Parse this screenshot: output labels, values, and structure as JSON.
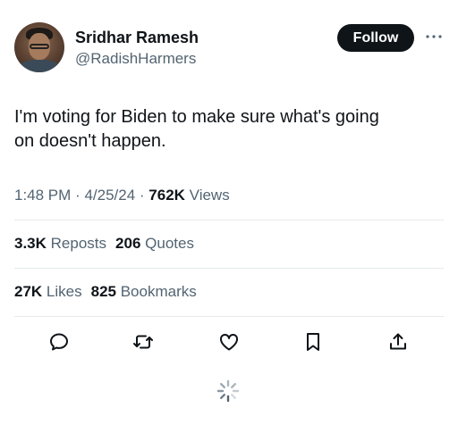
{
  "author": {
    "name": "Sridhar Ramesh",
    "handle": "@RadishHarmers",
    "avatar_icon": "profile-photo"
  },
  "follow_label": "Follow",
  "tweet": {
    "lines": [
      "I'm voting for Biden to make sure what's going",
      "on doesn't happen."
    ],
    "time": "1:48 PM",
    "date": "4/25/24",
    "views_count": "762K",
    "views_label": "Views"
  },
  "stats": {
    "reposts_count": "3.3K",
    "reposts_label": "Reposts",
    "quotes_count": "206",
    "quotes_label": "Quotes",
    "likes_count": "27K",
    "likes_label": "Likes",
    "bookmarks_count": "825",
    "bookmarks_label": "Bookmarks"
  },
  "actions": {
    "icons": [
      "reply-icon",
      "repost-icon",
      "like-icon",
      "bookmark-icon",
      "share-icon"
    ]
  },
  "colors": {
    "text": "#0f1419",
    "secondary": "#536471",
    "divider": "#e6e9ec",
    "button_bg": "#0f1419"
  }
}
